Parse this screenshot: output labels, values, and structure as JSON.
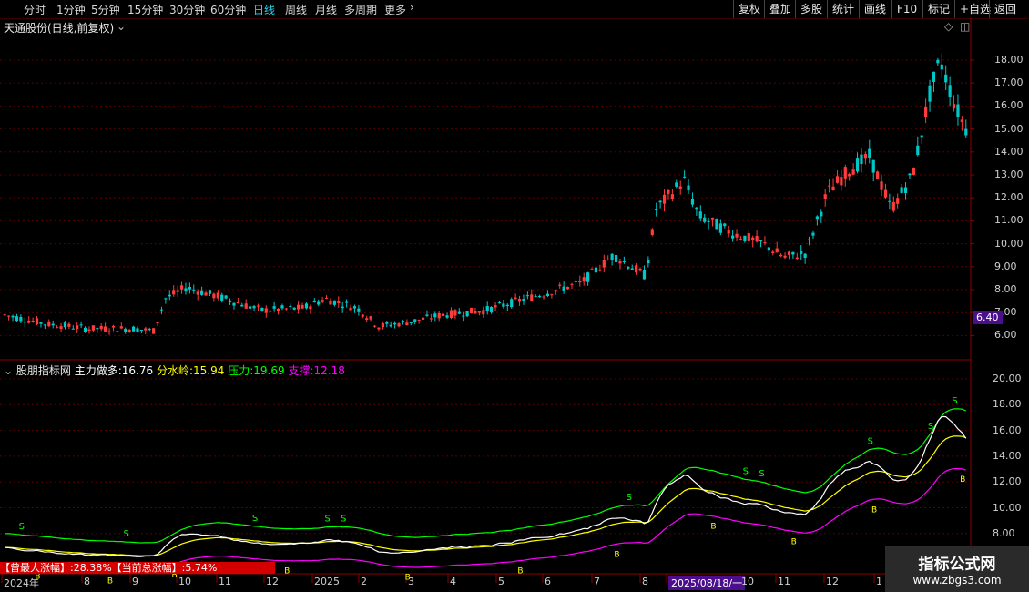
{
  "periods": [
    "分时",
    "1分钟",
    "5分钟",
    "15分钟",
    "30分钟",
    "60分钟",
    "日线",
    "周线",
    "月线",
    "多周期",
    "更多"
  ],
  "active_period": "日线",
  "toolbar": [
    "复权",
    "叠加",
    "多股",
    "统计",
    "画线",
    "F10",
    "标记",
    "+自选",
    "返回"
  ],
  "stock_title": "天通股份(日线,前复权)",
  "price_axis": [
    "18.00",
    "17.00",
    "16.00",
    "15.00",
    "14.00",
    "13.00",
    "12.00",
    "11.00",
    "10.00",
    "9.00",
    "8.00",
    "7.00",
    "6.00"
  ],
  "current_price_tag": "6.40",
  "indicator": {
    "name": "股朋指标网",
    "main_label": "主力做多:",
    "main_value": "16.76",
    "water_label": "分水岭:",
    "water_value": "15.94",
    "press_label": "压力:",
    "press_value": "19.69",
    "support_label": "支撑:",
    "support_value": "12.18"
  },
  "indicator_axis": [
    "20.00",
    "18.00",
    "16.00",
    "14.00",
    "12.00",
    "10.00",
    "8.00"
  ],
  "signal_labels": {
    "sell": "S",
    "buy": "B"
  },
  "date_axis": [
    "2024年",
    "8",
    "9",
    "10",
    "11",
    "12",
    "2025",
    "2",
    "3",
    "4",
    "5",
    "6",
    "7",
    "8",
    "2025/08/18/一",
    "10",
    "11",
    "12",
    "1"
  ],
  "banner": {
    "max_rise_label": "【曾最大涨幅】:",
    "max_rise_value": "28.38%",
    "total_rise_label": "【当前总涨幅】:",
    "total_rise_value": "5.74%"
  },
  "watermark": {
    "name": "指标公式网",
    "url": "www.zbgs3.com"
  },
  "colors": {
    "up": "#ff3b3b",
    "down": "#00c8c8",
    "support": "#ff00ff",
    "pressure": "#00ff00",
    "water": "#ffff00",
    "main": "#ffffff"
  }
}
